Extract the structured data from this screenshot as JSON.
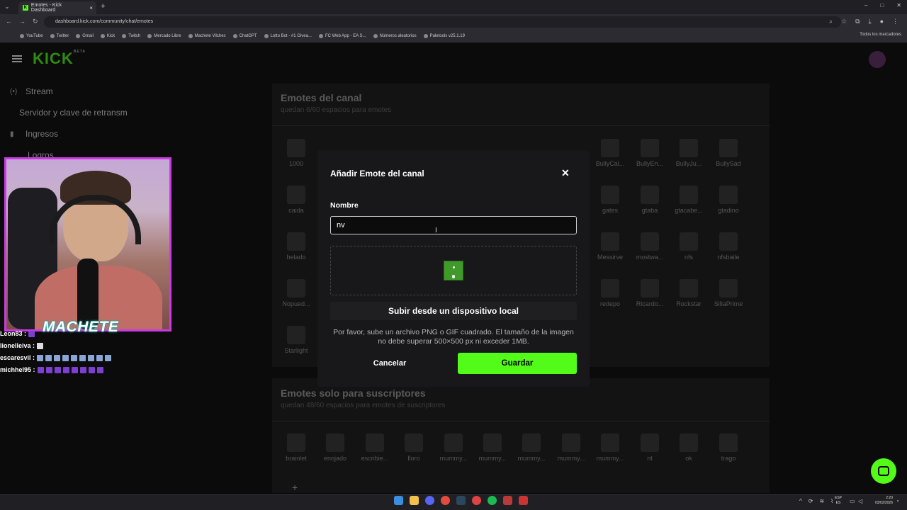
{
  "browser": {
    "tab_title": "Emotes - Kick Dashboard",
    "url": "dashboard.kick.com/community/chat/emotes",
    "bookmarks": [
      "YouTube",
      "Twitter",
      "Gmail",
      "Kick",
      "Twitch",
      "Mercado Libre",
      "Machete Vilches",
      "ChatGPT",
      "Lotto Bot - #1 Givea...",
      "FC Web App - EA S...",
      "Números aleatorios",
      "Paletools v25.1.19"
    ],
    "bookmarks_all": "Todos los marcadores"
  },
  "brand": {
    "logo": "KICK",
    "beta": "BETA"
  },
  "sidebar": {
    "items": [
      {
        "label": "Stream",
        "icon": "broadcast-icon"
      },
      {
        "label": "Servidor y clave de retransm",
        "icon": ""
      },
      {
        "label": "Ingresos",
        "icon": "bar-chart-icon"
      },
      {
        "label": "Logros",
        "icon": ""
      }
    ]
  },
  "channel_emotes": {
    "title": "Emotes del canal",
    "subtitle": "quedan 6/60 espacios para emotes",
    "emotes": [
      "1000",
      "BullyCal...",
      "BullyEn...",
      "BullyJu...",
      "BullySad",
      "caida",
      "gates",
      "gtaba",
      "gtacabe...",
      "gtadino",
      "helado",
      "Messirve",
      "mostwa...",
      "nfs",
      "nfsbaile",
      "Nopued...",
      "redepo",
      "Ricardo...",
      "Rockstar",
      "SillaPrime",
      "Starlight"
    ]
  },
  "sub_emotes": {
    "title": "Emotes solo para suscriptores",
    "subtitle": "quedan 48/60 espacios para emotes de suscriptores",
    "emotes": [
      "brainlet",
      "enojado",
      "escribie...",
      "lloro",
      "mummy...",
      "mummy...",
      "mummy...",
      "mummy...",
      "mummy...",
      "nt",
      "ok",
      "trago"
    ]
  },
  "modal": {
    "title": "Añadir Emote del canal",
    "name_label": "Nombre",
    "name_value": "nv",
    "upload_label": "Subir desde un dispositivo local",
    "hint": "Por favor, sube un archivo PNG o GIF cuadrado. El tamaño de la imagen no debe superar 500×500 px ni exceder 1MB.",
    "cancel_label": "Cancelar",
    "save_label": "Guardar"
  },
  "overlay": {
    "cam_label": "MACHETE",
    "chat": [
      {
        "user": "Leon83 :",
        "emotes": 1,
        "kind": "p"
      },
      {
        "user": "lionelleiva :",
        "emotes": 1,
        "kind": "w"
      },
      {
        "user": "escaresvil :",
        "emotes": 9,
        "kind": "b"
      },
      {
        "user": "michhel95 :",
        "emotes": 8,
        "kind": "p"
      }
    ]
  },
  "taskbar": {
    "lang_top": "ESP",
    "lang_bottom": "ES",
    "time": "2:20",
    "date": "03/02/2026"
  },
  "colors": {
    "accent": "#53fc18",
    "cam_border": "#c93ae3"
  }
}
